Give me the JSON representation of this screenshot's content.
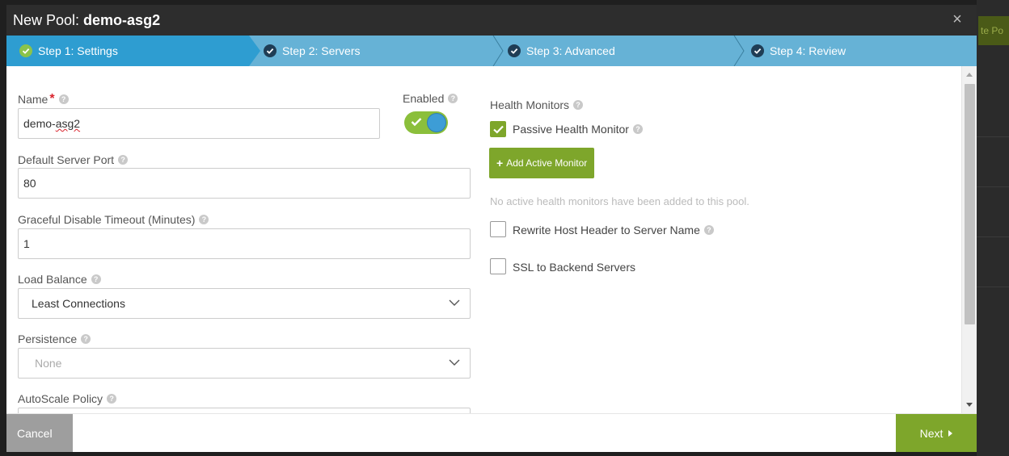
{
  "modal": {
    "title_prefix": "New Pool: ",
    "title_name": "demo-asg2",
    "close_icon": "×"
  },
  "background": {
    "button_label": "te Po"
  },
  "wizard": {
    "steps": [
      {
        "label": "Step 1: Settings",
        "state": "active"
      },
      {
        "label": "Step 2: Servers",
        "state": "pending"
      },
      {
        "label": "Step 3: Advanced",
        "state": "pending"
      },
      {
        "label": "Step 4: Review",
        "state": "pending"
      }
    ]
  },
  "form": {
    "name": {
      "label": "Name",
      "required_mark": "*",
      "value_prefix": "demo-",
      "value_misspelled": "asg2"
    },
    "enabled": {
      "label": "Enabled",
      "value": true
    },
    "default_server_port": {
      "label": "Default Server Port",
      "value": "80"
    },
    "graceful_disable_timeout": {
      "label": "Graceful Disable Timeout (Minutes)",
      "value": "1"
    },
    "load_balance": {
      "label": "Load Balance",
      "value": "Least Connections"
    },
    "persistence": {
      "label": "Persistence",
      "value": "None"
    },
    "autoscale_policy": {
      "label": "AutoScale Policy"
    },
    "health_monitors": {
      "label": "Health Monitors",
      "passive_label": "Passive Health Monitor",
      "passive_checked": true,
      "add_button": "Add Active Monitor",
      "empty_message": "No active health monitors have been added to this pool."
    },
    "rewrite_host_header": {
      "label": "Rewrite Host Header to Server Name",
      "checked": false
    },
    "ssl_to_backend": {
      "label": "SSL to Backend Servers",
      "checked": false
    }
  },
  "footer": {
    "cancel_label": "Cancel",
    "next_label": "Next"
  },
  "icons": {
    "help": "?",
    "plus": "+"
  },
  "colors": {
    "accent_green": "#7ea62b",
    "wizard_active": "#2e9dd1",
    "wizard_bg": "#66b2d6",
    "header_bg": "#2d2d2d",
    "required_red": "#d9232d"
  }
}
